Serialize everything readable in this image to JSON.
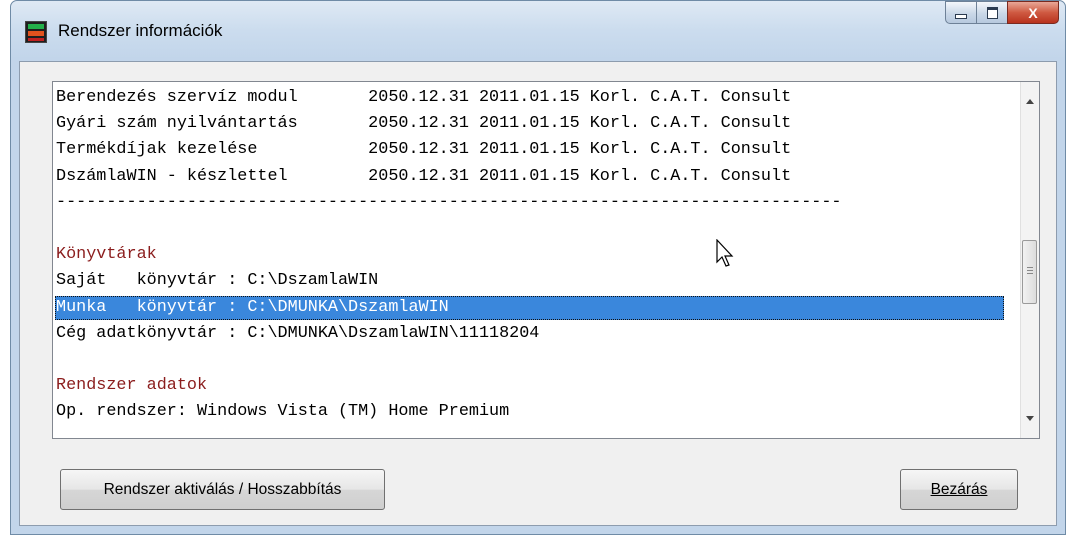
{
  "window": {
    "title": "Rendszer információk",
    "controls": {
      "minimize": "minimize",
      "maximize": "maximize",
      "close": "X"
    }
  },
  "listbox": {
    "lines": [
      {
        "text": "Berendezés szervíz modul       2050.12.31 2011.01.15 Korl. C.A.T. Consult",
        "style": "normal"
      },
      {
        "text": "Gyári szám nyilvántartás       2050.12.31 2011.01.15 Korl. C.A.T. Consult",
        "style": "normal"
      },
      {
        "text": "Termékdíjak kezelése           2050.12.31 2011.01.15 Korl. C.A.T. Consult",
        "style": "normal"
      },
      {
        "text": "DszámlaWIN - készlettel        2050.12.31 2011.01.15 Korl. C.A.T. Consult",
        "style": "normal"
      },
      {
        "text": "------------------------------------------------------------------------------",
        "style": "normal"
      },
      {
        "text": "",
        "style": "normal"
      },
      {
        "text": "Könyvtárak",
        "style": "heading"
      },
      {
        "text": "Saját   könyvtár : C:\\DszamlaWIN",
        "style": "normal"
      },
      {
        "text": "Munka   könyvtár : C:\\DMUNKA\\DszamlaWIN",
        "style": "selected"
      },
      {
        "text": "Cég adatkönyvtár : C:\\DMUNKA\\DszamlaWIN\\11118204",
        "style": "normal"
      },
      {
        "text": "",
        "style": "normal"
      },
      {
        "text": "Rendszer adatok",
        "style": "heading"
      },
      {
        "text": "Op. rendszer: Windows Vista (TM) Home Premium",
        "style": "normal"
      }
    ]
  },
  "buttons": {
    "activate": "Rendszer aktiválás / Hosszabbítás",
    "close": "Bezárás"
  }
}
